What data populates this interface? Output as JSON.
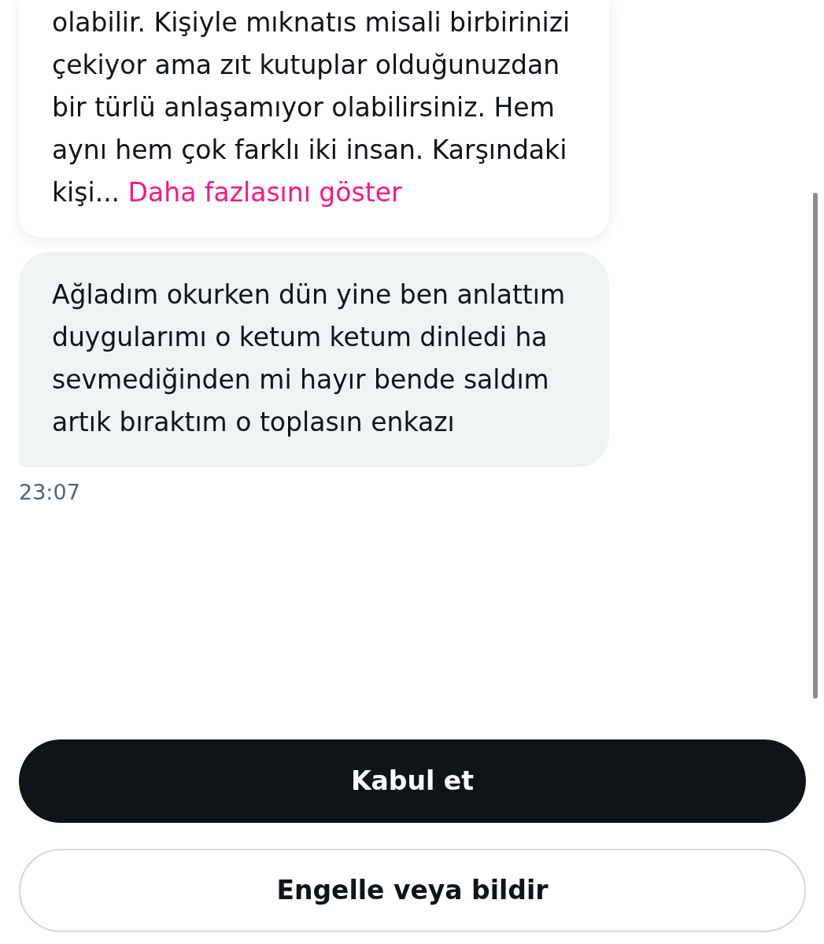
{
  "messages": [
    {
      "kind": "card",
      "text": "olabilir. Kişiyle mıknatıs misali birbirinizi çekiyor ama zıt kutuplar olduğunuzdan bir türlü anlaşamıyor olabilirsiniz. Hem aynı hem çok farklı iki insan. Karşındaki kişi...",
      "more_link": "Daha fazlasını göster"
    },
    {
      "kind": "bubble",
      "text": "Ağladım okurken dün yine ben anlattım duygularımı o ketum ketum dinledi ha sevmediğinden mi hayır bende saldım artık bıraktım o toplasın enkazı"
    }
  ],
  "timestamp": "23:07",
  "buttons": [
    {
      "kind": "primary",
      "label": "Kabul et"
    },
    {
      "kind": "outline",
      "label": "Engelle veya bildir"
    }
  ]
}
